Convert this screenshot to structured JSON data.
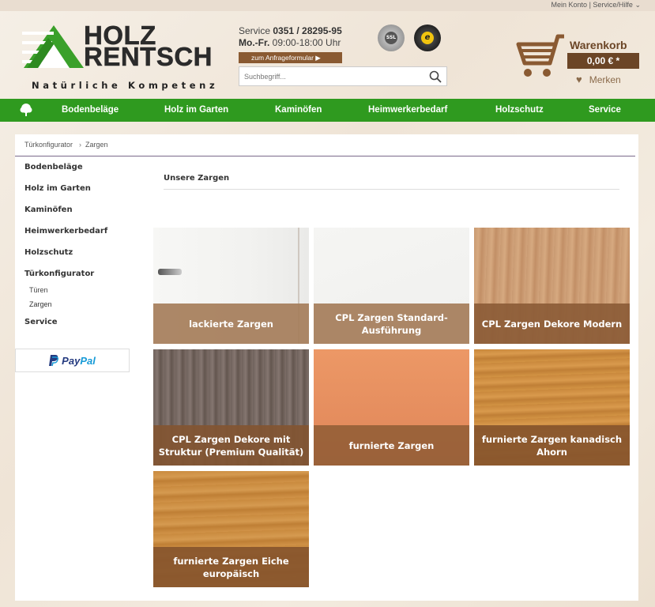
{
  "topbar": {
    "mein_konto": "Mein Konto",
    "separator": "|",
    "service_hilfe": "Service/Hilfe"
  },
  "logo": {
    "word1": "HOLZ",
    "word2": "RENTSCH",
    "slogan": "Natürliche Kompetenz"
  },
  "service": {
    "label": "Service",
    "phone": "0351 / 28295-95",
    "days": "Mo.-Fr.",
    "hours": "09:00-18:00 Uhr",
    "form_button": "zum Anfrageformular ▶"
  },
  "seals": {
    "ssl": "SSL",
    "trusted": "e"
  },
  "search": {
    "placeholder": "Suchbegriff..."
  },
  "cart": {
    "title": "Warenkorb",
    "total": "0,00 € *",
    "merken": "Merken"
  },
  "nav": {
    "items": [
      "Bodenbeläge",
      "Holz im Garten",
      "Kaminöfen",
      "Heimwerkerbedarf",
      "Holzschutz",
      "Service"
    ]
  },
  "breadcrumb": {
    "item1": "Türkonfigurator",
    "sep": "›",
    "item2": "Zargen"
  },
  "sidebar": {
    "categories": [
      "Bodenbeläge",
      "Holz im Garten",
      "Kaminöfen",
      "Heimwerkerbedarf",
      "Holzschutz",
      "Türkonfigurator"
    ],
    "subs": [
      "Türen",
      "Zargen"
    ],
    "service": "Service",
    "paypal1": "Pay",
    "paypal2": "Pal"
  },
  "main": {
    "title": "Unsere Zargen",
    "tiles": [
      "lackierte Zargen",
      "CPL Zargen Standard-Ausführung",
      "CPL Zargen Dekore Modern",
      "CPL Zargen Dekore mit Struktur (Premium Qualität)",
      "furnierte Zargen",
      "furnierte Zargen kanadisch Ahorn",
      "furnierte Zargen Eiche europäisch"
    ]
  },
  "colors": {
    "nav_green": "#2f9a1f",
    "brand_brown": "#6b4526",
    "tile_label_bg": "rgba(120,80,45,0.85)"
  }
}
